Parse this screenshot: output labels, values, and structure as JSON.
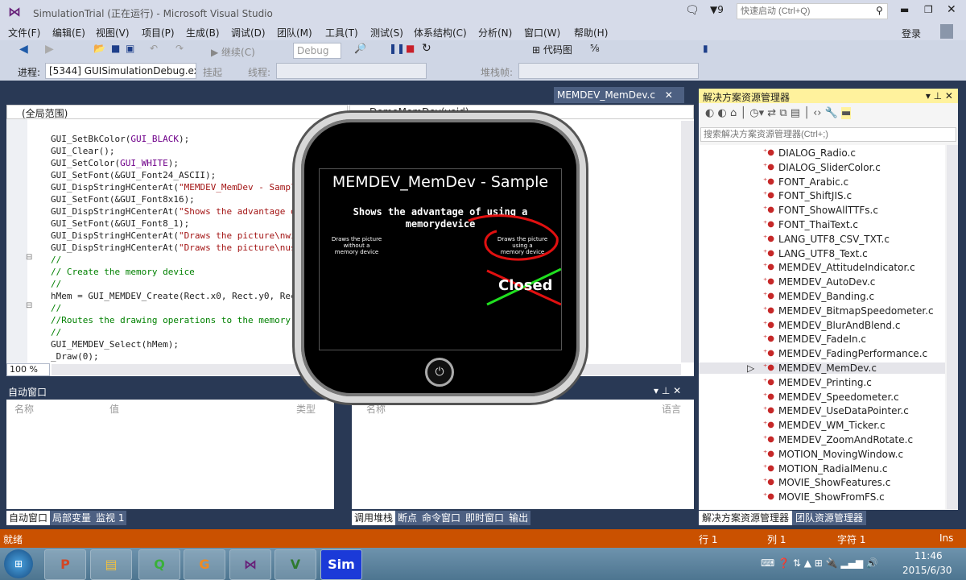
{
  "window": {
    "title": "SimulationTrial (正在运行) - Microsoft Visual Studio",
    "notifications": "9",
    "quick_launch_placeholder": "快速启动 (Ctrl+Q)",
    "login": "登录"
  },
  "menu": [
    "文件(F)",
    "编辑(E)",
    "视图(V)",
    "项目(P)",
    "生成(B)",
    "调试(D)",
    "团队(M)",
    "工具(T)",
    "测试(S)",
    "体系结构(C)",
    "分析(N)",
    "窗口(W)",
    "帮助(H)"
  ],
  "toolbar": {
    "continue": "继续(C)",
    "config": "Debug",
    "code_map": "代码图",
    "process_label": "进程:",
    "process_value": "[5344] GUISimulationDebug.exe",
    "suspend": "挂起",
    "thread_label": "线程:",
    "stack_label": "堆栈帧:"
  },
  "editor": {
    "tab": "MEMDEV_MemDev.c",
    "scope": "(全局范围)",
    "function": "DemoMemDev(void)",
    "zoom": "100 %",
    "lines": [
      [
        {
          "t": "GUI_SetBkColor(",
          "c": "plain"
        },
        {
          "t": "GUI_BLACK",
          "c": "kw"
        },
        {
          "t": ");",
          "c": "plain"
        }
      ],
      [
        {
          "t": "GUI_Clear();",
          "c": "plain"
        }
      ],
      [
        {
          "t": "GUI_SetColor(",
          "c": "plain"
        },
        {
          "t": "GUI_WHITE",
          "c": "kw"
        },
        {
          "t": ");",
          "c": "plain"
        }
      ],
      [
        {
          "t": "GUI_SetFont(&GUI_Font24_ASCII);",
          "c": "plain"
        }
      ],
      [
        {
          "t": "GUI_DispStringHCenterAt(",
          "c": "plain"
        },
        {
          "t": "\"MEMDEV_MemDev - Sample",
          "c": "str"
        }
      ],
      [
        {
          "t": "GUI_SetFont(&GUI_Font8x16);",
          "c": "plain"
        }
      ],
      [
        {
          "t": "GUI_DispStringHCenterAt(",
          "c": "plain"
        },
        {
          "t": "\"Shows the advantage of",
          "c": "str"
        }
      ],
      [
        {
          "t": "GUI_SetFont(&GUI_Font8_1);",
          "c": "plain"
        }
      ],
      [
        {
          "t": "GUI_DispStringHCenterAt(",
          "c": "plain"
        },
        {
          "t": "\"Draws the picture\\nwit",
          "c": "str"
        }
      ],
      [
        {
          "t": "GUI_DispStringHCenterAt(",
          "c": "plain"
        },
        {
          "t": "\"Draws the picture\\nusi",
          "c": "str"
        }
      ],
      [
        {
          "t": "//",
          "c": "cmt"
        }
      ],
      [
        {
          "t": "// Create the memory device",
          "c": "cmt"
        }
      ],
      [
        {
          "t": "//",
          "c": "cmt"
        }
      ],
      [
        {
          "t": "hMem = GUI_MEMDEV_Create(Rect.x0, Rect.y0, Rect",
          "c": "plain"
        }
      ],
      [
        {
          "t": "//",
          "c": "cmt"
        }
      ],
      [
        {
          "t": "//Routes the drawing operations to the memory d",
          "c": "cmt"
        }
      ],
      [
        {
          "t": "//",
          "c": "cmt"
        }
      ],
      [
        {
          "t": "GUI_MEMDEV_Select(hMem);",
          "c": "plain"
        }
      ],
      [
        {
          "t": "_Draw(0);",
          "c": "plain"
        }
      ]
    ]
  },
  "simulator": {
    "title": "MEMDEV_MemDev - Sample",
    "subtitle": "Shows the advantage of using a",
    "subtitle2": "memorydevice",
    "left_caption": "Draws the picture\nwithout a\nmemory device",
    "right_caption": "Draws the picture\nusing a\nmemory device",
    "annotation": "Closed"
  },
  "autos": {
    "title": "自动窗口",
    "columns": [
      "名称",
      "值",
      "类型"
    ],
    "tabs": [
      "自动窗口",
      "局部变量",
      "监视 1"
    ]
  },
  "callstack": {
    "columns": [
      "名称",
      "语言"
    ],
    "tabs": [
      "调用堆栈",
      "断点",
      "命令窗口",
      "即时窗口",
      "输出"
    ]
  },
  "solution_explorer": {
    "title": "解决方案资源管理器",
    "search_placeholder": "搜索解决方案资源管理器(Ctrl+;)",
    "selected": "MEMDEV_MemDev.c",
    "items": [
      "DIALOG_Radio.c",
      "DIALOG_SliderColor.c",
      "FONT_Arabic.c",
      "FONT_ShiftJIS.c",
      "FONT_ShowAllTTFs.c",
      "FONT_ThaiText.c",
      "LANG_UTF8_CSV_TXT.c",
      "LANG_UTF8_Text.c",
      "MEMDEV_AttitudeIndicator.c",
      "MEMDEV_AutoDev.c",
      "MEMDEV_Banding.c",
      "MEMDEV_BitmapSpeedometer.c",
      "MEMDEV_BlurAndBlend.c",
      "MEMDEV_FadeIn.c",
      "MEMDEV_FadingPerformance.c",
      "MEMDEV_MemDev.c",
      "MEMDEV_Printing.c",
      "MEMDEV_Speedometer.c",
      "MEMDEV_UseDataPointer.c",
      "MEMDEV_WM_Ticker.c",
      "MEMDEV_ZoomAndRotate.c",
      "MOTION_MovingWindow.c",
      "MOTION_RadialMenu.c",
      "MOVIE_ShowFeatures.c",
      "MOVIE_ShowFromFS.c"
    ],
    "tabs": [
      "解决方案资源管理器",
      "团队资源管理器"
    ]
  },
  "status": {
    "ready": "就绪",
    "line": "行 1",
    "col": "列 1",
    "char": "字符 1",
    "mode": "Ins"
  },
  "taskbar": {
    "apps": [
      "powerpoint",
      "explorer",
      "qq",
      "foxit-pdf",
      "visual-studio",
      "vs-addin",
      "emwin-sim"
    ],
    "sim_label": "Sim",
    "time": "11:46",
    "date": "2015/6/30"
  },
  "colors": {
    "status": "#ca5100",
    "accent_panel": "#fff29d",
    "string": "#a31515",
    "comment": "#008000",
    "keyword": "#6f008a"
  }
}
